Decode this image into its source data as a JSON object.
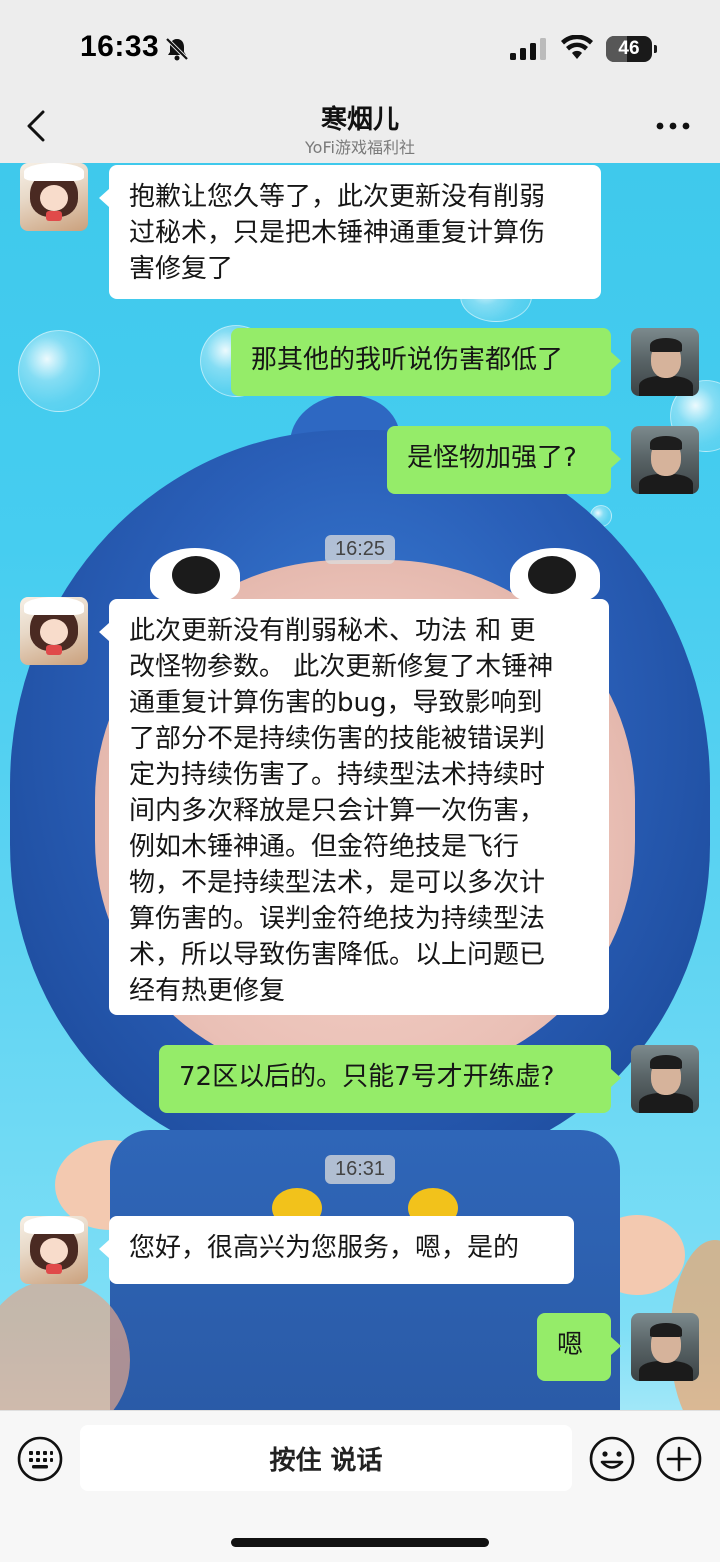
{
  "status_bar": {
    "time": "16:33",
    "battery_level": "46"
  },
  "header": {
    "title": "寒烟儿",
    "subtitle": "YoFi游戏福利社",
    "back_icon": "chevron-left-icon",
    "more_icon": "more-dots-icon"
  },
  "messages": [
    {
      "sender": "agent",
      "text": "抱歉让您久等了，此次更新没有削弱\n过秘术，只是把木锤神通重复计算伤\n害修复了"
    },
    {
      "sender": "user",
      "text": "那其他的我听说伤害都低了"
    },
    {
      "sender": "user",
      "text": "是怪物加强了?"
    },
    {
      "type": "time",
      "text": "16:25"
    },
    {
      "sender": "agent",
      "text": "此次更新没有削弱秘术、功法 和 更\n改怪物参数。 此次更新修复了木锤神\n通重复计算伤害的bug，导致影响到\n了部分不是持续伤害的技能被错误判\n定为持续伤害了。持续型法术持续时\n间内多次释放是只会计算一次伤害，\n例如木锤神通。但金符绝技是飞行\n物，不是持续型法术，是可以多次计\n算伤害的。误判金符绝技为持续型法\n术，所以导致伤害降低。以上问题已\n经有热更修复"
    },
    {
      "sender": "user",
      "text": "72区以后的。只能7号才开练虚?"
    },
    {
      "type": "time",
      "text": "16:31"
    },
    {
      "sender": "agent",
      "text": "您好，很高兴为您服务，嗯，是的"
    },
    {
      "sender": "user",
      "text": "嗯"
    }
  ],
  "input_bar": {
    "voice_label": "按住 说话",
    "keyboard_icon": "keyboard-icon",
    "emoji_icon": "emoji-icon",
    "plus_icon": "plus-icon"
  },
  "colors": {
    "outgoing_bubble": "#95ec69",
    "incoming_bubble": "#ffffff",
    "header_bg": "#ededed"
  }
}
